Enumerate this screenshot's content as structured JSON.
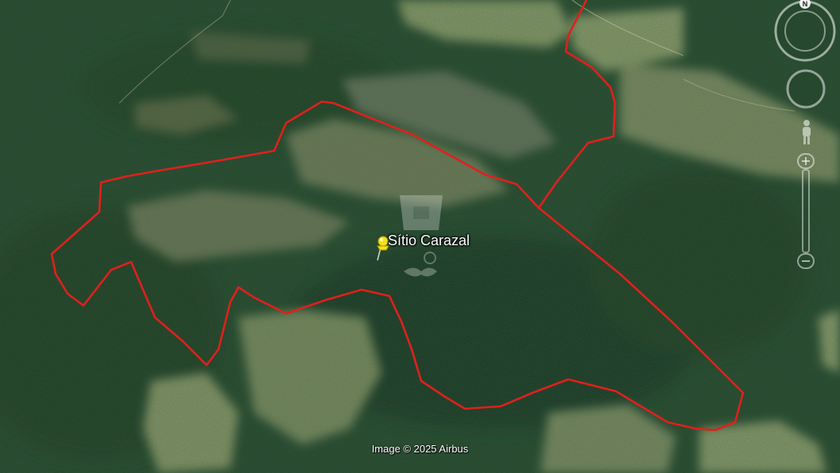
{
  "placemark": {
    "label": "Sítio Carazal",
    "icon": "yellow-pushpin-icon"
  },
  "attribution": "Image © 2025 Airbus",
  "compass": {
    "north_label": "N",
    "icon": "compass-icon"
  },
  "controls": {
    "look_icon": "look-around-icon",
    "pegman_icon": "street-view-pegman-icon",
    "zoom_icon": "zoom-slider-icon"
  },
  "colors": {
    "boundary": "#e0201c",
    "pushpin": "#f2e21a",
    "forest": "#1f4226",
    "pasture": "#7c8660"
  }
}
